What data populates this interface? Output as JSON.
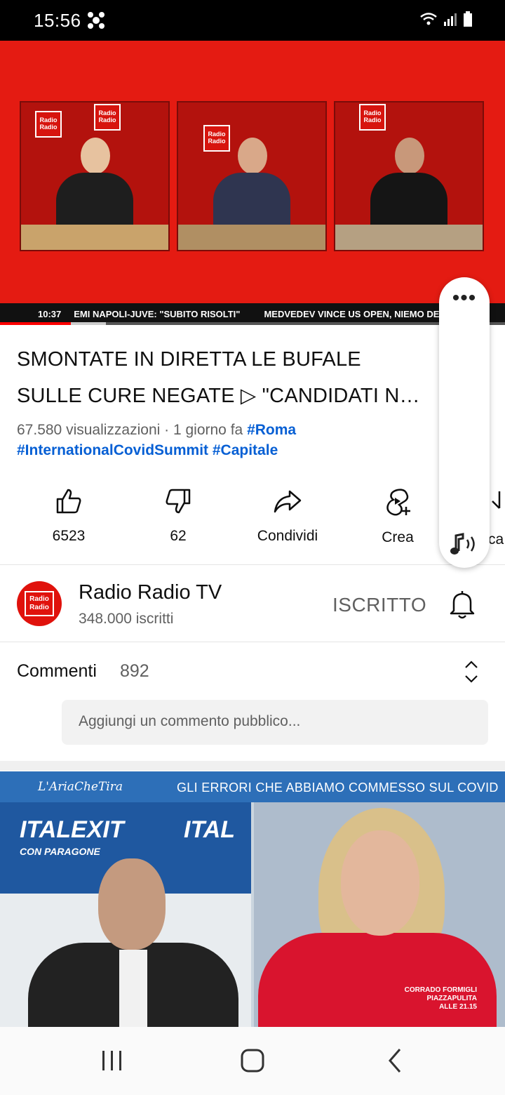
{
  "status_bar": {
    "time": "15:56"
  },
  "player": {
    "ticker_time": "10:37",
    "ticker_text_1": "EMI NAPOLI-JUVE: \"SUBITO RISOLTI\"",
    "ticker_text_2": "MEDVEDEV VINCE US OPEN, NIEMO DE",
    "panel_logo": "Radio Radio",
    "progress_played": 0.14,
    "progress_buffered": 0.21
  },
  "video": {
    "title_line_1": "SMONTATE IN DIRETTA LE BUFALE",
    "title_line_2": "SULLE CURE NEGATE ▷ \"CANDIDATI N…",
    "views": "67.580 visualizzazioni",
    "separator": " · ",
    "age": "1 giorno fa",
    "tag_1": "#Roma",
    "tag_2": "#InternationalCovidSummit",
    "tag_3": "#Capitale"
  },
  "actions": {
    "like_count": "6523",
    "dislike_count": "62",
    "share_label": "Condividi",
    "create_label": "Crea",
    "partial_label": "ca"
  },
  "channel": {
    "avatar_text": "Radio Radio",
    "name": "Radio Radio TV",
    "subscribers": "348.000 iscritti",
    "subscribe_label": "ISCRITTO"
  },
  "comments": {
    "label": "Commenti",
    "count": "892",
    "placeholder": "Aggiungi un commento pubblico..."
  },
  "next_video": {
    "show_name": "L'AriaCheTira",
    "headline": "GLI ERRORI CHE ABBIAMO COMMESSO SUL COVID",
    "brand_left": "ITALEXIT",
    "brand_sub": "CON PARAGONE",
    "brand_right": "ITAL",
    "caption_line_1": "CORRADO FORMIGLI",
    "caption_line_2": "PIAZZAPULITA",
    "caption_line_3": "ALLE 21.15"
  },
  "colors": {
    "accent_red": "#ff0000",
    "link_blue": "#065fd4",
    "secondary_text": "#606060"
  }
}
